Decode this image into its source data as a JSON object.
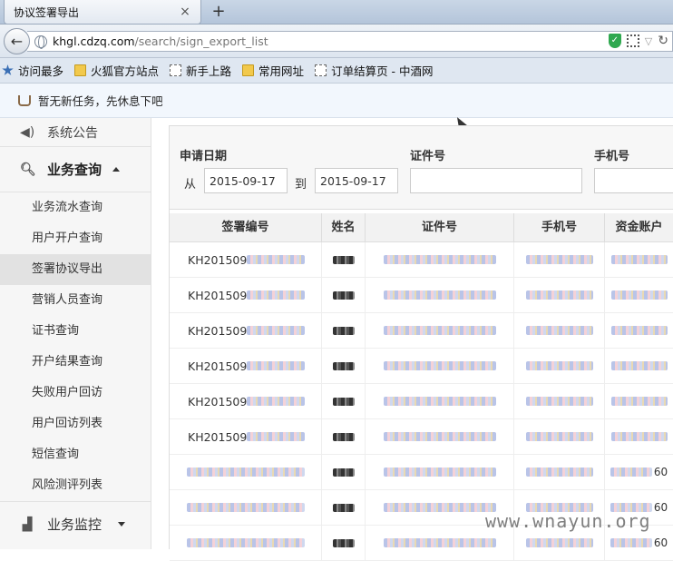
{
  "browser": {
    "tab_title": "协议签署导出",
    "tab_close": "×",
    "new_tab": "+",
    "url_host": "khgl.cdzq.com",
    "url_path": "/search/sign_export_list",
    "bookmarks": [
      {
        "label": "访问最多",
        "icon": "star"
      },
      {
        "label": "火狐官方站点",
        "icon": "folder"
      },
      {
        "label": "新手上路",
        "icon": "page"
      },
      {
        "label": "常用网址",
        "icon": "folder"
      },
      {
        "label": "订单结算页 - 中酒网",
        "icon": "page"
      }
    ]
  },
  "notice": {
    "text": "暂无新任务，先休息下吧"
  },
  "sidebar": {
    "announce": "系统公告",
    "query_group": "业务查询",
    "items": [
      {
        "label": "业务流水查询",
        "active": false
      },
      {
        "label": "用户开户查询",
        "active": false
      },
      {
        "label": "签署协议导出",
        "active": true
      },
      {
        "label": "营销人员查询",
        "active": false
      },
      {
        "label": "证书查询",
        "active": false
      },
      {
        "label": "开户结果查询",
        "active": false
      },
      {
        "label": "失败用户回访",
        "active": false
      },
      {
        "label": "用户回访列表",
        "active": false
      },
      {
        "label": "短信查询",
        "active": false
      },
      {
        "label": "风险测评列表",
        "active": false
      }
    ],
    "monitor_group": "业务监控"
  },
  "filter": {
    "date_label": "申请日期",
    "from_label": "从",
    "from_value": "2015-09-17",
    "to_label": "到",
    "to_value": "2015-09-17",
    "id_label": "证件号",
    "id_value": "",
    "phone_label": "手机号",
    "phone_value": ""
  },
  "table": {
    "headers": [
      "签署编号",
      "姓名",
      "证件号",
      "手机号",
      "资金账户"
    ],
    "code_prefix": "KH201509",
    "rows_with_code": 6,
    "trailing_text": "60"
  },
  "watermark": "www.wnayun.org"
}
